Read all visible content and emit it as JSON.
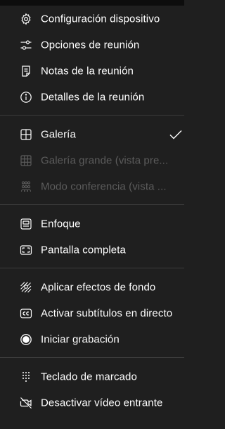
{
  "menu": {
    "section1": [
      {
        "label": "Configuración dispositivo",
        "icon": "gear-icon"
      },
      {
        "label": "Opciones de reunión",
        "icon": "sliders-icon"
      },
      {
        "label": "Notas de la reunión",
        "icon": "notes-icon"
      },
      {
        "label": "Detalles de la reunión",
        "icon": "info-icon"
      }
    ],
    "section2": [
      {
        "label": "Galería",
        "icon": "grid-icon",
        "checked": true
      },
      {
        "label": "Galería grande (vista pre...",
        "icon": "large-grid-icon",
        "disabled": true
      },
      {
        "label": "Modo conferencia (vista ...",
        "icon": "people-icon",
        "disabled": true
      }
    ],
    "section3": [
      {
        "label": "Enfoque",
        "icon": "focus-icon"
      },
      {
        "label": "Pantalla completa",
        "icon": "fullscreen-icon"
      }
    ],
    "section4": [
      {
        "label": "Aplicar efectos de fondo",
        "icon": "background-effects-icon"
      },
      {
        "label": "Activar subtítulos en directo",
        "icon": "captions-icon"
      },
      {
        "label": "Iniciar grabación",
        "icon": "record-icon"
      }
    ],
    "section5": [
      {
        "label": "Teclado de marcado",
        "icon": "dialpad-icon"
      },
      {
        "label": "Desactivar vídeo entrante",
        "icon": "video-off-icon"
      }
    ]
  },
  "colors": {
    "background": "#1f1f1f",
    "text": "#ffffff",
    "disabled_text": "#5c5c5c",
    "divider": "#3b3b3b"
  }
}
